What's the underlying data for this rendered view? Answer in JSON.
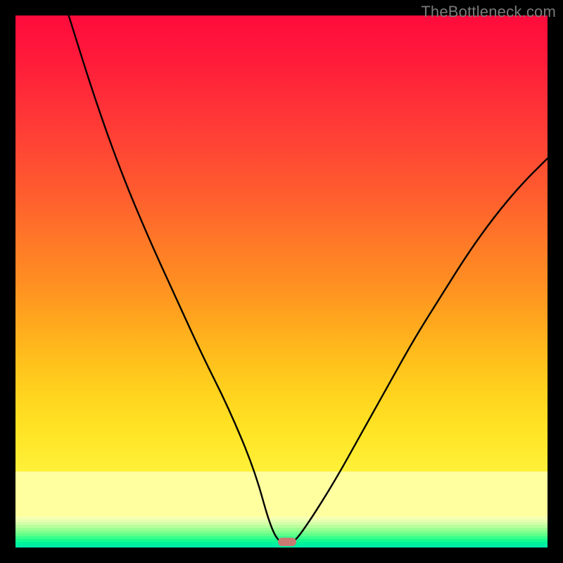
{
  "watermark": "TheBottleneck.com",
  "chart_data": {
    "type": "line",
    "title": "",
    "xlabel": "",
    "ylabel": "",
    "xlim": [
      0,
      100
    ],
    "ylim": [
      0,
      100
    ],
    "grid": false,
    "legend": false,
    "series": [
      {
        "name": "bottleneck-curve",
        "color": "#000000",
        "x": [
          10,
          15,
          20,
          25,
          30,
          35,
          40,
          45,
          48,
          50,
          52,
          55,
          60,
          65,
          70,
          75,
          80,
          85,
          90,
          95,
          100
        ],
        "y": [
          100,
          84,
          70,
          58,
          47,
          36,
          26,
          14,
          3,
          0,
          0,
          4,
          12,
          21,
          30,
          39,
          47,
          55,
          62,
          68,
          73
        ]
      }
    ],
    "annotations": [
      {
        "name": "min-marker",
        "x": 51,
        "y": 0.5,
        "color": "#c97a72",
        "shape": "rounded-rect"
      }
    ],
    "background_gradient": {
      "orientation": "vertical",
      "stops": [
        {
          "pos": 0.0,
          "color": "#ff0b3c"
        },
        {
          "pos": 0.25,
          "color": "#ff4634"
        },
        {
          "pos": 0.5,
          "color": "#ff8e22"
        },
        {
          "pos": 0.78,
          "color": "#ffe424"
        },
        {
          "pos": 0.86,
          "color": "#fff13a"
        },
        {
          "pos": 0.93,
          "color": "#fffd55"
        },
        {
          "pos": 1.0,
          "color": "#ffff62"
        }
      ],
      "bottom_bands": [
        "#ffffa0",
        "#f5ffb2",
        "#e6ffb0",
        "#d2ffa8",
        "#b8ff9d",
        "#9cff93",
        "#7fff8d",
        "#5eff8a",
        "#39ff8c",
        "#15fd90",
        "#00f59a",
        "#00eca6"
      ]
    }
  },
  "plot": {
    "frame_color": "#000000",
    "inner_left": 22,
    "inner_top": 22,
    "inner_width": 756,
    "inner_height": 756
  }
}
